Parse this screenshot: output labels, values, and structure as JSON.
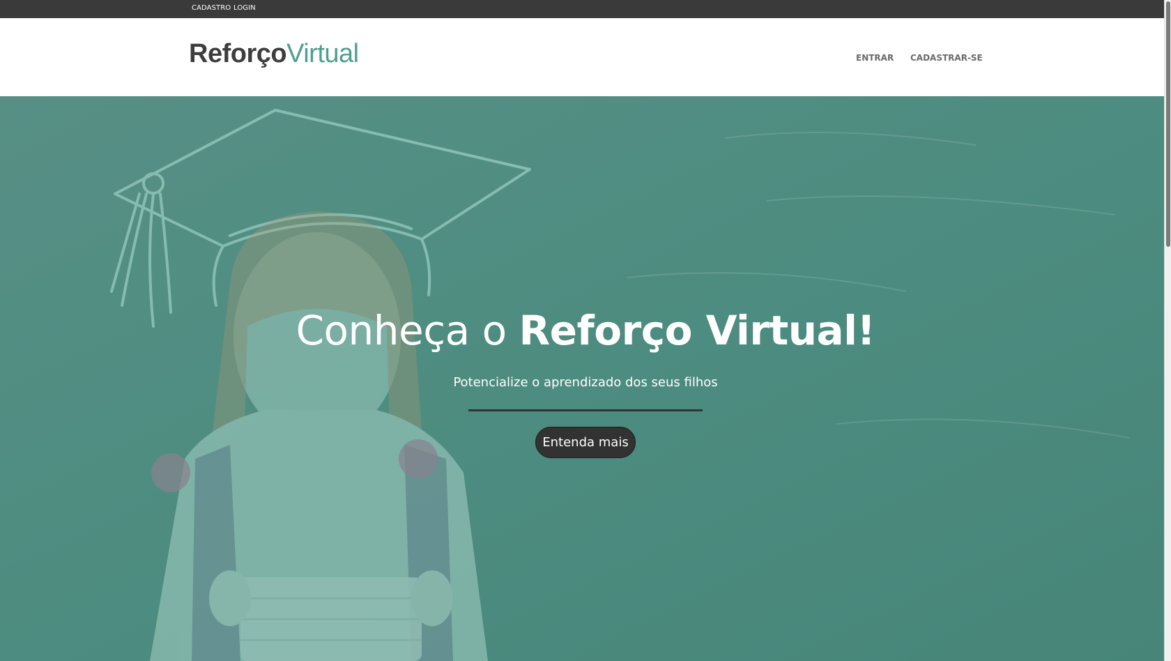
{
  "topbar": {
    "links": [
      "CADASTRO",
      "LOGIN"
    ]
  },
  "header": {
    "logo": {
      "part1": "Reforço",
      "part2": "Virtual"
    },
    "nav": [
      "ENTRAR",
      "CADASTRAR-SE"
    ]
  },
  "hero": {
    "title_light": "Conheça o ",
    "title_bold": "Reforço Virtual!",
    "subtitle": "Potencialize o aprendizado dos seus filhos",
    "button_label": "Entenda mais"
  },
  "colors": {
    "topbar_bg": "#3a3a3a",
    "brand_dark": "#3d3d3d",
    "brand_accent": "#4f9e90",
    "hero_overlay": "#4e8f83",
    "button_bg": "#323232"
  }
}
